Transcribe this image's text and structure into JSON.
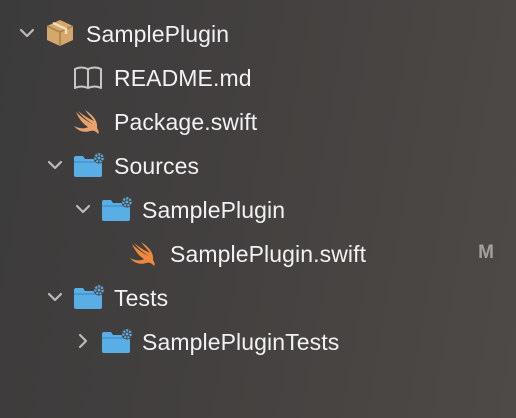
{
  "navigator": {
    "items": [
      {
        "label": "SamplePlugin",
        "icon": "package-icon",
        "expanded": true
      },
      {
        "label": "README.md",
        "icon": "book-icon"
      },
      {
        "label": "Package.swift",
        "icon": "swift-icon"
      },
      {
        "label": "Sources",
        "icon": "folder-icon",
        "expanded": true
      },
      {
        "label": "SamplePlugin",
        "icon": "folder-icon",
        "expanded": true
      },
      {
        "label": "SamplePlugin.swift",
        "icon": "swift-icon",
        "status": "M"
      },
      {
        "label": "Tests",
        "icon": "folder-icon",
        "expanded": true
      },
      {
        "label": "SamplePluginTests",
        "icon": "folder-icon",
        "expanded": false
      }
    ]
  },
  "colors": {
    "folder": "#5aaee6",
    "swift": "#f0883d",
    "package": "#d4a86a",
    "text": "#f2f2f2",
    "chevron": "#bdbbb9",
    "status": "#a3a09e"
  }
}
